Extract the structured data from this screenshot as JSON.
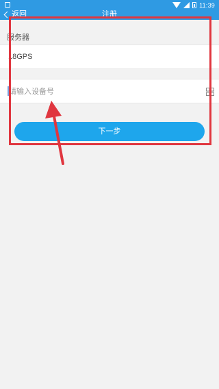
{
  "status_bar": {
    "time": "11:39"
  },
  "nav": {
    "back_label": "返回",
    "title": "注册"
  },
  "form": {
    "server_label": "服务器",
    "server_value": "18GPS",
    "device_placeholder": "请输入设备号",
    "next_button_label": "下一步"
  },
  "colors": {
    "accent": "#2f9ae3",
    "button": "#1ea6ec",
    "annotation": "#e0363f"
  }
}
